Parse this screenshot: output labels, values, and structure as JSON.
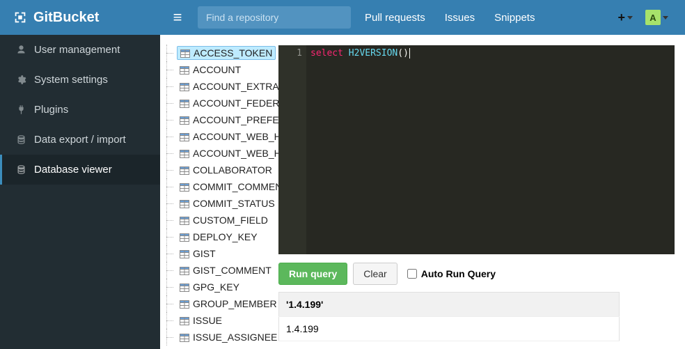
{
  "brand": {
    "title": "GitBucket"
  },
  "search": {
    "placeholder": "Find a repository"
  },
  "nav": {
    "pull_requests": "Pull requests",
    "issues": "Issues",
    "snippets": "Snippets"
  },
  "avatar": {
    "initial": "A"
  },
  "sidebar": {
    "items": [
      {
        "label": "User management",
        "icon": "user"
      },
      {
        "label": "System settings",
        "icon": "gear"
      },
      {
        "label": "Plugins",
        "icon": "plug"
      },
      {
        "label": "Data export / import",
        "icon": "database"
      },
      {
        "label": "Database viewer",
        "icon": "database",
        "active": true
      }
    ]
  },
  "tree": {
    "tables": [
      "ACCESS_TOKEN",
      "ACCOUNT",
      "ACCOUNT_EXTRA_",
      "ACCOUNT_FEDERA",
      "ACCOUNT_PREFER",
      "ACCOUNT_WEB_H",
      "ACCOUNT_WEB_H",
      "COLLABORATOR",
      "COMMIT_COMMEN",
      "COMMIT_STATUS",
      "CUSTOM_FIELD",
      "DEPLOY_KEY",
      "GIST",
      "GIST_COMMENT",
      "GPG_KEY",
      "GROUP_MEMBER",
      "ISSUE",
      "ISSUE_ASSIGNEE"
    ],
    "selected_index": 0
  },
  "editor": {
    "line_no": "1",
    "code": {
      "kw": "select",
      "sp": " ",
      "fn": "H2VERSION",
      "paren": "()"
    }
  },
  "controls": {
    "run": "Run query",
    "clear": "Clear",
    "auto_run": "Auto Run Query"
  },
  "result": {
    "header": "'1.4.199'",
    "value": "1.4.199"
  }
}
